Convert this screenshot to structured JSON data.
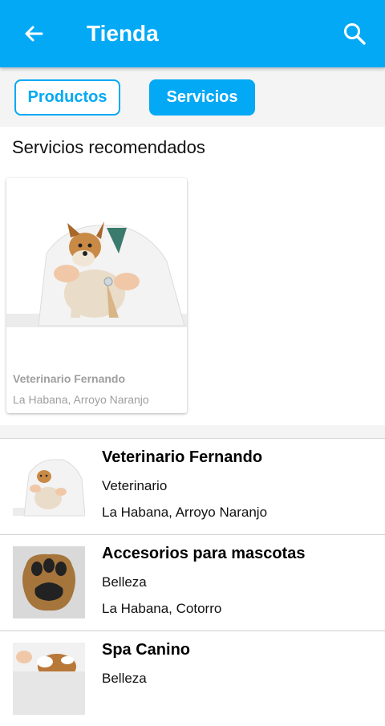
{
  "appbar": {
    "title": "Tienda",
    "back_icon": "arrow-left-icon",
    "search_icon": "search-icon",
    "color": "#03a9f4"
  },
  "tabs": [
    {
      "label": "Productos",
      "selected": false
    },
    {
      "label": "Servicios",
      "selected": true
    }
  ],
  "recommended": {
    "title": "Servicios recomendados",
    "cards": [
      {
        "name": "Veterinario Fernando",
        "location": "La Habana, Arroyo Naranjo",
        "image": "vet-with-dog-photo"
      }
    ]
  },
  "services": [
    {
      "name": "Veterinario Fernando",
      "category": "Veterinario",
      "location": "La Habana, Arroyo Naranjo",
      "image": "vet-with-dog-photo"
    },
    {
      "name": "Accesorios para mascotas",
      "category": "Belleza",
      "location": "La Habana, Cotorro",
      "image": "paw-mat-photo"
    },
    {
      "name": "Spa Canino",
      "category": "Belleza",
      "location": "",
      "image": "dog-bath-photo"
    }
  ]
}
